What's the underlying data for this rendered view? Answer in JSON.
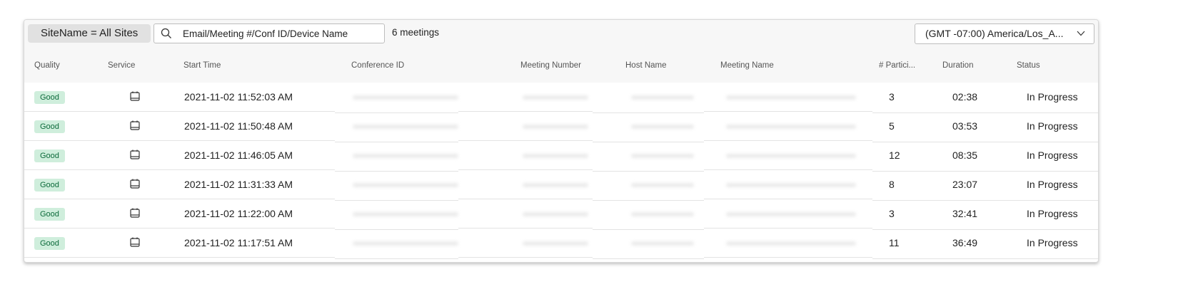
{
  "toolbar": {
    "filter_label": "SiteName = All Sites",
    "search_placeholder": "Email/Meeting #/Conf ID/Device Name",
    "meeting_count": "6  meetings",
    "timezone": "(GMT -07:00) America/Los_A..."
  },
  "columns": [
    "Quality",
    "Service",
    "Start Time",
    "Conference ID",
    "Meeting Number",
    "Host Name",
    "Meeting Name",
    "# Partici...",
    "Duration",
    "Status"
  ],
  "rows": [
    {
      "quality": "Good",
      "service_icon": "calendar-icon",
      "start_time": "2021-11-02 11:52:03 AM",
      "participants": "3",
      "duration": "02:38",
      "status": "In Progress"
    },
    {
      "quality": "Good",
      "service_icon": "calendar-icon",
      "start_time": "2021-11-02 11:50:48 AM",
      "participants": "5",
      "duration": "03:53",
      "status": "In Progress"
    },
    {
      "quality": "Good",
      "service_icon": "calendar-icon",
      "start_time": "2021-11-02 11:46:05 AM",
      "participants": "12",
      "duration": "08:35",
      "status": "In Progress"
    },
    {
      "quality": "Good",
      "service_icon": "calendar-icon",
      "start_time": "2021-11-02 11:31:33 AM",
      "participants": "8",
      "duration": "23:07",
      "status": "In Progress"
    },
    {
      "quality": "Good",
      "service_icon": "calendar-icon",
      "start_time": "2021-11-02 11:22:00 AM",
      "participants": "3",
      "duration": "32:41",
      "status": "In Progress"
    },
    {
      "quality": "Good",
      "service_icon": "calendar-icon",
      "start_time": "2021-11-02 11:17:51 AM",
      "participants": "11",
      "duration": "36:49",
      "status": "In Progress"
    }
  ],
  "colors": {
    "quality_good_bg": "#cfeedc",
    "quality_good_text": "#0c6a3a",
    "toolbar_bg": "#f7f7f7"
  }
}
